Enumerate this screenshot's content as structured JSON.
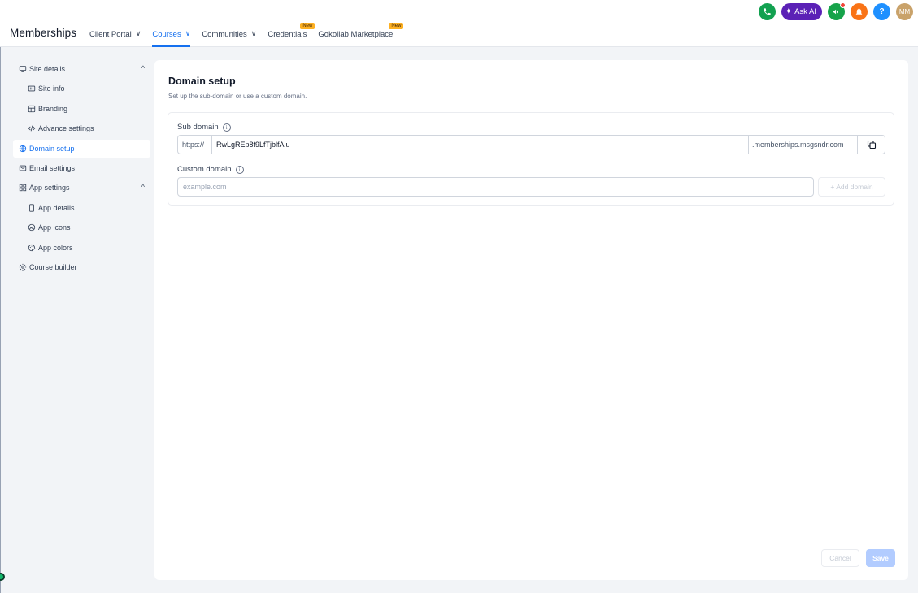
{
  "header": {
    "app_title": "Memberships",
    "nav": [
      {
        "label": "Client Portal",
        "has_chevron": true,
        "active": false
      },
      {
        "label": "Courses",
        "has_chevron": true,
        "active": true
      },
      {
        "label": "Communities",
        "has_chevron": true,
        "active": false
      },
      {
        "label": "Credentials",
        "badge": "New",
        "active": false
      },
      {
        "label": "Gokollab Marketplace",
        "badge": "New",
        "active": false
      }
    ],
    "chevron": "∨",
    "actions": {
      "ask_ai": "Ask AI",
      "help": "?",
      "avatar_initials": "MM"
    }
  },
  "sidebar": {
    "items": [
      {
        "label": "Site details",
        "icon": "monitor-icon",
        "level": 0,
        "expanded": true
      },
      {
        "label": "Site info",
        "icon": "id-card-icon",
        "level": 1
      },
      {
        "label": "Branding",
        "icon": "layout-icon",
        "level": 1
      },
      {
        "label": "Advance settings",
        "icon": "code-icon",
        "level": 1
      },
      {
        "label": "Domain setup",
        "icon": "globe-icon",
        "level": 0,
        "active": true
      },
      {
        "label": "Email settings",
        "icon": "mail-icon",
        "level": 0
      },
      {
        "label": "App settings",
        "icon": "grid-icon",
        "level": 0,
        "expanded": true
      },
      {
        "label": "App details",
        "icon": "phone-device-icon",
        "level": 1
      },
      {
        "label": "App icons",
        "icon": "image-icon",
        "level": 1
      },
      {
        "label": "App colors",
        "icon": "palette-icon",
        "level": 1
      },
      {
        "label": "Course builder",
        "icon": "gear-icon",
        "level": 0
      }
    ],
    "caret_up": "^"
  },
  "main": {
    "title": "Domain setup",
    "subtitle": "Set up the sub-domain or use a custom domain.",
    "sub_domain": {
      "label": "Sub domain",
      "prefix": "https://",
      "value": "RwLgREp8f9LfTjblfAlu",
      "suffix": ".memberships.msgsndr.com"
    },
    "custom_domain": {
      "label": "Custom domain",
      "placeholder": "example.com",
      "add_label": "+ Add domain"
    },
    "info_glyph": "i",
    "footer": {
      "cancel_label": "Cancel",
      "save_label": "Save"
    }
  },
  "colors": {
    "accent": "#1570ef",
    "badge": "#fdb022",
    "ask_ai": "#5b21b6",
    "phone": "#12a150",
    "bell": "#f97316",
    "help": "#1e90ff"
  }
}
